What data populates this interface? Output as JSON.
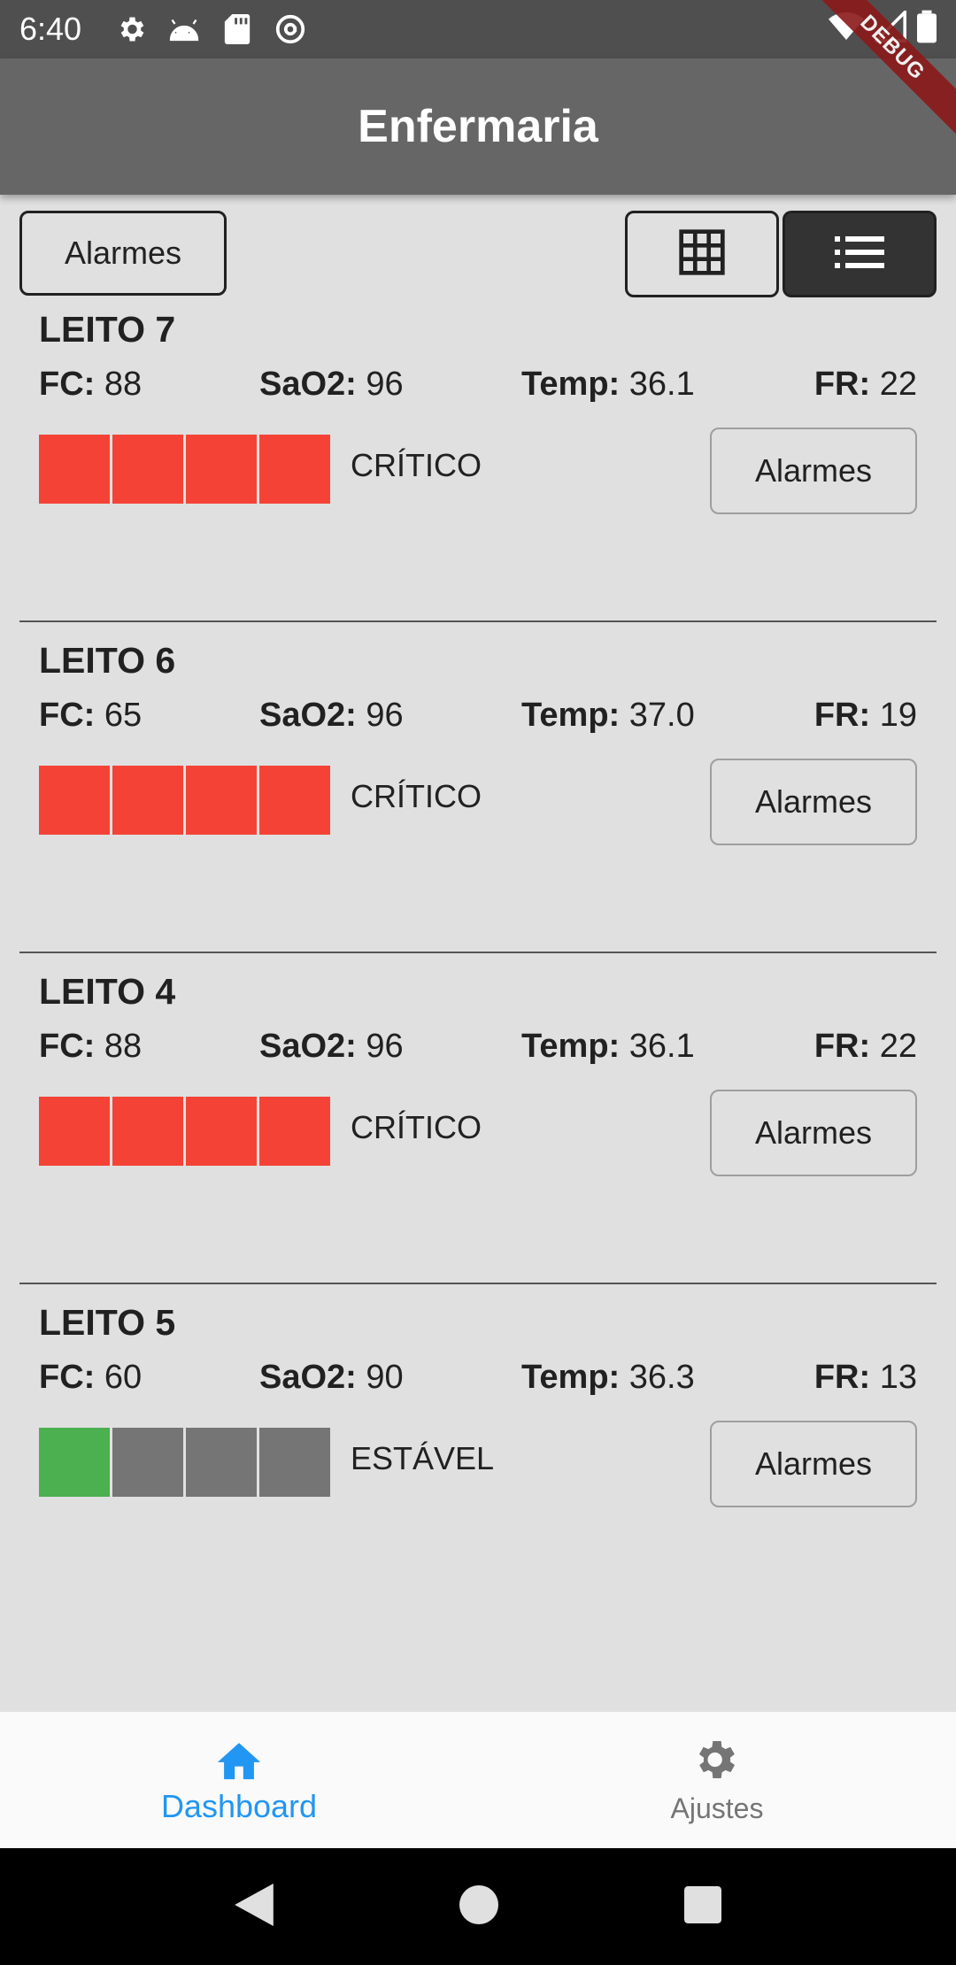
{
  "status_bar": {
    "time": "6:40",
    "icons": [
      "gear-icon",
      "android-icon",
      "sd-card-icon",
      "at-sign-icon",
      "wifi-icon",
      "signal-icon",
      "battery-icon"
    ]
  },
  "debug_banner": "DEBUG",
  "app_bar": {
    "title": "Enfermaria"
  },
  "toolbar": {
    "alarms_label": "Alarmes",
    "view_modes": [
      "grid-icon",
      "list-icon"
    ],
    "active_view": "list"
  },
  "colors": {
    "critical": "#f44336",
    "stable": "#4caf50",
    "inactive_cell": "#757575",
    "accent": "#2196f3"
  },
  "beds": [
    {
      "title": "LEITO 7",
      "fc_label": "FC:",
      "fc": "88",
      "sao2_label": "SaO2:",
      "sao2": "96",
      "temp_label": "Temp:",
      "temp": "36.1",
      "fr_label": "FR:",
      "fr": "22",
      "score_cells": [
        "critical",
        "critical",
        "critical",
        "critical"
      ],
      "status": "CRÍTICO",
      "alarms_label": "Alarmes"
    },
    {
      "title": "LEITO 6",
      "fc_label": "FC:",
      "fc": "65",
      "sao2_label": "SaO2:",
      "sao2": "96",
      "temp_label": "Temp:",
      "temp": "37.0",
      "fr_label": "FR:",
      "fr": "19",
      "score_cells": [
        "critical",
        "critical",
        "critical",
        "critical"
      ],
      "status": "CRÍTICO",
      "alarms_label": "Alarmes"
    },
    {
      "title": "LEITO 4",
      "fc_label": "FC:",
      "fc": "88",
      "sao2_label": "SaO2:",
      "sao2": "96",
      "temp_label": "Temp:",
      "temp": "36.1",
      "fr_label": "FR:",
      "fr": "22",
      "score_cells": [
        "critical",
        "critical",
        "critical",
        "critical"
      ],
      "status": "CRÍTICO",
      "alarms_label": "Alarmes"
    },
    {
      "title": "LEITO 5",
      "fc_label": "FC:",
      "fc": "60",
      "sao2_label": "SaO2:",
      "sao2": "90",
      "temp_label": "Temp:",
      "temp": "36.3",
      "fr_label": "FR:",
      "fr": "13",
      "score_cells": [
        "stable",
        "inactive_cell",
        "inactive_cell",
        "inactive_cell"
      ],
      "status": "ESTÁVEL",
      "alarms_label": "Alarmes"
    }
  ],
  "bottom_nav": {
    "items": [
      {
        "label": "Dashboard",
        "icon": "home-icon",
        "active": true
      },
      {
        "label": "Ajustes",
        "icon": "settings-gear-icon",
        "active": false
      }
    ]
  },
  "system_nav": [
    "back-icon",
    "home-circle-icon",
    "recents-icon"
  ]
}
